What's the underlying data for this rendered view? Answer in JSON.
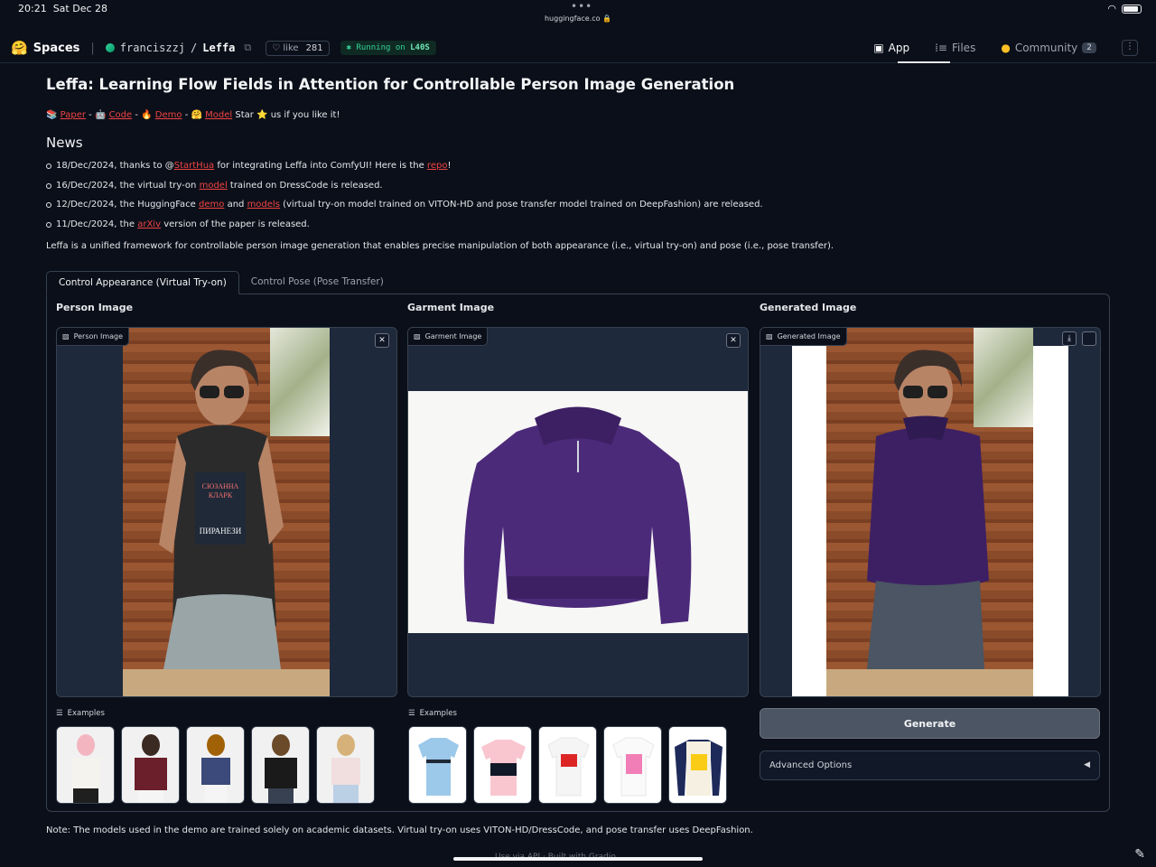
{
  "status": {
    "time": "20:21",
    "date": "Sat Dec 28",
    "url": "huggingface.co 🔒"
  },
  "header": {
    "logo": "🤗",
    "spaces": "Spaces",
    "owner": "franciszzj",
    "repo": "Leffa",
    "like_label": "like",
    "like_count": "281",
    "running": "Running on",
    "hardware": "L40S",
    "tabs": [
      {
        "label": "App",
        "icon": "▣"
      },
      {
        "label": "Files",
        "icon": "⁞≡"
      },
      {
        "label": "Community",
        "icon": "●",
        "count": "2"
      }
    ]
  },
  "page": {
    "title": "Leffa: Learning Flow Fields in Attention for Controllable Person Image Generation",
    "links": {
      "paper_icon": "📚",
      "paper": "Paper",
      "code_icon": "🤖",
      "code": "Code",
      "demo_icon": "🔥",
      "demo": "Demo",
      "model_icon": "🤗",
      "model": "Model",
      "star_text": "Star",
      "star_icon": "⭐",
      "star_suffix": "us if you like it!"
    },
    "news_heading": "News",
    "news": [
      {
        "pre": "18/Dec/2024, thanks to @",
        "link1": "StartHua",
        "mid": " for integrating Leffa into ComfyUI! Here is the ",
        "link2": "repo",
        "post": "!"
      },
      {
        "pre": "16/Dec/2024, the virtual try-on ",
        "link1": "model",
        "mid": " trained on DressCode is released.",
        "link2": "",
        "post": ""
      },
      {
        "pre": "12/Dec/2024, the HuggingFace ",
        "link1": "demo",
        "mid": " and ",
        "link2": "models",
        "post": " (virtual try-on model trained on VITON-HD and pose transfer model trained on DeepFashion) are released."
      },
      {
        "pre": "11/Dec/2024, the ",
        "link1": "arXiv",
        "mid": " version of the paper is released.",
        "link2": "",
        "post": ""
      }
    ],
    "intro": "Leffa is a unified framework for controllable person image generation that enables precise manipulation of both appearance (i.e., virtual try-on) and pose (i.e., pose transfer).",
    "tabs": [
      "Control Appearance (Virtual Try-on)",
      "Control Pose (Pose Transfer)"
    ],
    "columns": {
      "person": {
        "label": "Person Image",
        "chip": "Person Image"
      },
      "garment": {
        "label": "Garment Image",
        "chip": "Garment Image"
      },
      "generated": {
        "label": "Generated Image",
        "chip": "Generated Image"
      }
    },
    "book_text": {
      "line1": "СЮЗАННА",
      "line2": "КЛАРК",
      "line3": "ПИРАНЕЗИ"
    },
    "examples_label": "Examples",
    "generate_label": "Generate",
    "advanced_label": "Advanced Options",
    "note": "Note: The models used in the demo are trained solely on academic datasets. Virtual try-on uses VITON-HD/DressCode, and pose transfer uses DeepFashion.",
    "footer": "Use via API  ·  Built with Gradio"
  }
}
